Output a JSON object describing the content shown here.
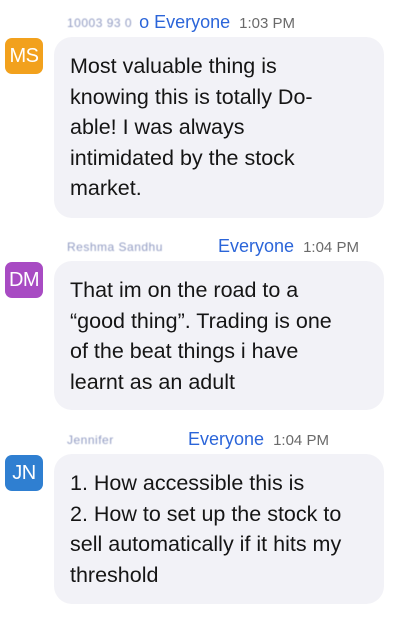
{
  "messages": [
    {
      "sender_name": "10003 93 0",
      "to_word": "o",
      "recipient": "Everyone",
      "time": "1:03 PM",
      "avatar_initials": "MS",
      "avatar_color": "#f2a11d",
      "text": "Most valuable thing is\nknowing this is totally Do-\nable! I was always\nintimidated by the stock\nmarket."
    },
    {
      "sender_name": "Reshma Sandhu",
      "to_word": "",
      "recipient": "Everyone",
      "time": "1:04 PM",
      "avatar_initials": "DM",
      "avatar_color": "#a84bc3",
      "text": "That im on the road to a\n“good thing”. Trading is one\nof the beat things i have\nlearnt as an adult"
    },
    {
      "sender_name": "Jennifer",
      "to_word": "",
      "recipient": "Everyone",
      "time": "1:04 PM",
      "avatar_initials": "JN",
      "avatar_color": "#2f7fd1",
      "text": "1. How accessible this is\n2. How to set up the stock to\nsell automatically if it hits my\nthreshold"
    }
  ]
}
